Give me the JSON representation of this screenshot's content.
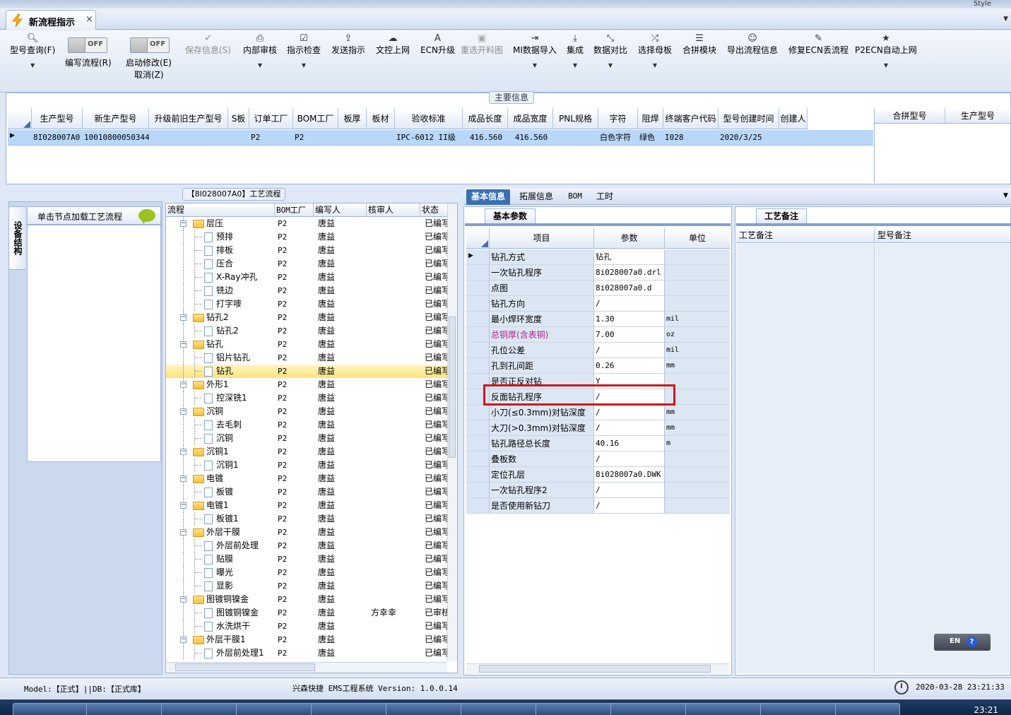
{
  "window": {
    "style_label": "Style",
    "tab_title": "新流程指示",
    "tab_close": "×"
  },
  "toolbar": {
    "items": [
      {
        "label": "型号查询(F)",
        "icon": "search-icon"
      },
      {
        "label": "编写流程(R)",
        "toggle": "OFF"
      },
      {
        "label": "启动修改(E)",
        "label2": "取消(Z)",
        "toggle": "OFF"
      },
      {
        "label": "保存信息(S)",
        "icon": "check-icon",
        "disabled": true
      },
      {
        "label": "内部审核",
        "icon": "printer-icon"
      },
      {
        "label": "指示检查",
        "icon": "checklist-icon"
      },
      {
        "label": "发送指示",
        "icon": "upload-icon"
      },
      {
        "label": "文控上网",
        "icon": "cloud-upload-icon"
      },
      {
        "label": "ECN升级",
        "icon": "ecn-icon"
      },
      {
        "label": "重选开料图",
        "icon": "image-icon",
        "disabled": true
      },
      {
        "label": "MI数据导入",
        "icon": "import-icon"
      },
      {
        "label": "集成",
        "icon": "download-icon"
      },
      {
        "label": "数据对比",
        "icon": "compare-icon"
      },
      {
        "label": "选择母板",
        "icon": "shuffle-icon"
      },
      {
        "label": "合拼模块",
        "icon": "list-icon"
      },
      {
        "label": "导出流程信息",
        "icon": "smile-icon"
      },
      {
        "label": "修复ECN丢流程",
        "icon": "wrench-icon"
      },
      {
        "label": "P2ECN自动上网",
        "icon": "star-icon"
      }
    ]
  },
  "main_info": {
    "title": "主要信息",
    "columns": [
      "生产型号",
      "新生产型号",
      "升级前旧生产型号",
      "S板",
      "订单工厂",
      "BOM工厂",
      "板厚",
      "板材",
      "验收标准",
      "成品长度",
      "成品宽度",
      "PNL规格",
      "字符",
      "阻焊",
      "终端客户代码",
      "型号创建时间",
      "创建人"
    ],
    "row": [
      "8I028007A0",
      "10010800050344",
      "",
      "",
      "P2",
      "P2",
      "",
      "",
      "IPC-6012 II级",
      "416.560",
      "416.560",
      "",
      "白色字符",
      "绿色",
      "I028",
      "2020/3/25",
      ""
    ],
    "side_columns": [
      "合拼型号",
      "生产型号"
    ]
  },
  "left_panel": {
    "vertical_tab": "设备结构",
    "header": "单击节点加载工艺流程"
  },
  "tree": {
    "title": "【8I028007A0】工艺流程",
    "columns": [
      "流程",
      "BOM工厂",
      "编写人",
      "核审人",
      "状态"
    ],
    "rows": [
      {
        "name": "层压",
        "level": 0,
        "bom": "P2",
        "writer": "唐益",
        "reviewer": "",
        "status": "已编写"
      },
      {
        "name": "预排",
        "level": 1,
        "bom": "P2",
        "writer": "唐益",
        "reviewer": "",
        "status": "已编写"
      },
      {
        "name": "排板",
        "level": 1,
        "bom": "P2",
        "writer": "唐益",
        "reviewer": "",
        "status": "已编写"
      },
      {
        "name": "压合",
        "level": 1,
        "bom": "P2",
        "writer": "唐益",
        "reviewer": "",
        "status": "已编写"
      },
      {
        "name": "X-Ray冲孔",
        "level": 1,
        "bom": "P2",
        "writer": "唐益",
        "reviewer": "",
        "status": "已编写"
      },
      {
        "name": "铣边",
        "level": 1,
        "bom": "P2",
        "writer": "唐益",
        "reviewer": "",
        "status": "已编写"
      },
      {
        "name": "打字嘜",
        "level": 1,
        "bom": "P2",
        "writer": "唐益",
        "reviewer": "",
        "status": "已编写"
      },
      {
        "name": "钻孔2",
        "level": 0,
        "bom": "P2",
        "writer": "唐益",
        "reviewer": "",
        "status": "已编写"
      },
      {
        "name": "钻孔2",
        "level": 1,
        "bom": "P2",
        "writer": "唐益",
        "reviewer": "",
        "status": "已编写"
      },
      {
        "name": "钻孔",
        "level": 0,
        "bom": "P2",
        "writer": "唐益",
        "reviewer": "",
        "status": "已编写"
      },
      {
        "name": "铝片钻孔",
        "level": 1,
        "bom": "P2",
        "writer": "唐益",
        "reviewer": "",
        "status": "已编写"
      },
      {
        "name": "钻孔",
        "level": 1,
        "bom": "P2",
        "writer": "唐益",
        "reviewer": "",
        "status": "已编写",
        "selected": true
      },
      {
        "name": "外形1",
        "level": 0,
        "bom": "P2",
        "writer": "唐益",
        "reviewer": "",
        "status": "已编写"
      },
      {
        "name": "控深铣1",
        "level": 1,
        "bom": "P2",
        "writer": "唐益",
        "reviewer": "",
        "status": "已编写"
      },
      {
        "name": "沉铜",
        "level": 0,
        "bom": "P2",
        "writer": "唐益",
        "reviewer": "",
        "status": "已编写"
      },
      {
        "name": "去毛刺",
        "level": 1,
        "bom": "P2",
        "writer": "唐益",
        "reviewer": "",
        "status": "已编写"
      },
      {
        "name": "沉铜",
        "level": 1,
        "bom": "P2",
        "writer": "唐益",
        "reviewer": "",
        "status": "已编写"
      },
      {
        "name": "沉铜1",
        "level": 0,
        "bom": "P2",
        "writer": "唐益",
        "reviewer": "",
        "status": "已编写"
      },
      {
        "name": "沉铜1",
        "level": 1,
        "bom": "P2",
        "writer": "唐益",
        "reviewer": "",
        "status": "已编写"
      },
      {
        "name": "电镀",
        "level": 0,
        "bom": "P2",
        "writer": "唐益",
        "reviewer": "",
        "status": "已编写"
      },
      {
        "name": "板镀",
        "level": 1,
        "bom": "P2",
        "writer": "唐益",
        "reviewer": "",
        "status": "已编写"
      },
      {
        "name": "电镀1",
        "level": 0,
        "bom": "P2",
        "writer": "唐益",
        "reviewer": "",
        "status": "已编写"
      },
      {
        "name": "板镀1",
        "level": 1,
        "bom": "P2",
        "writer": "唐益",
        "reviewer": "",
        "status": "已编写"
      },
      {
        "name": "外层干膜",
        "level": 0,
        "bom": "P2",
        "writer": "唐益",
        "reviewer": "",
        "status": "已编写"
      },
      {
        "name": "外层前处理",
        "level": 1,
        "bom": "P2",
        "writer": "唐益",
        "reviewer": "",
        "status": "已编写"
      },
      {
        "name": "贴膜",
        "level": 1,
        "bom": "P2",
        "writer": "唐益",
        "reviewer": "",
        "status": "已编写"
      },
      {
        "name": "曝光",
        "level": 1,
        "bom": "P2",
        "writer": "唐益",
        "reviewer": "",
        "status": "已编写"
      },
      {
        "name": "显影",
        "level": 1,
        "bom": "P2",
        "writer": "唐益",
        "reviewer": "",
        "status": "已编写"
      },
      {
        "name": "图镀铜镍金",
        "level": 0,
        "bom": "P2",
        "writer": "唐益",
        "reviewer": "",
        "status": "已编写"
      },
      {
        "name": "图镀铜镍金",
        "level": 1,
        "bom": "P2",
        "writer": "唐益",
        "reviewer": "方幸幸",
        "status": "已审核"
      },
      {
        "name": "水洗烘干",
        "level": 1,
        "bom": "P2",
        "writer": "唐益",
        "reviewer": "",
        "status": "已编写"
      },
      {
        "name": "外层干膜1",
        "level": 0,
        "bom": "P2",
        "writer": "唐益",
        "reviewer": "",
        "status": "已编写"
      },
      {
        "name": "外层前处理1",
        "level": 1,
        "bom": "P2",
        "writer": "唐益",
        "reviewer": "",
        "status": "已编写"
      }
    ]
  },
  "right_tabs": [
    "基本信息",
    "拓展信息",
    "BOM",
    "工时"
  ],
  "basic": {
    "subtab": "基本参数",
    "columns": [
      "项目",
      "参数",
      "单位"
    ],
    "rows": [
      {
        "item": "钻孔方式",
        "value": "钻孔",
        "unit": ""
      },
      {
        "item": "一次钻孔程序",
        "value": "8i028007a0.drl",
        "unit": ""
      },
      {
        "item": "点图",
        "value": "8i028007a0.d",
        "unit": ""
      },
      {
        "item": "钻孔方向",
        "value": "/",
        "unit": ""
      },
      {
        "item": "最小焊环宽度",
        "value": "1.30",
        "unit": "mil"
      },
      {
        "item": "总铜厚(含表铜)",
        "value": "7.00",
        "unit": "oz",
        "pink": true
      },
      {
        "item": "孔位公差",
        "value": "/",
        "unit": "mil"
      },
      {
        "item": "孔到孔间距",
        "value": "0.26",
        "unit": "mm"
      },
      {
        "item": "是否正反对钻",
        "value": "Y",
        "unit": ""
      },
      {
        "item": "反面钻孔程序",
        "value": "/",
        "unit": ""
      },
      {
        "item": "小刀(≤0.3mm)对钻深度",
        "value": "/",
        "unit": "mm"
      },
      {
        "item": "大刀(>0.3mm)对钻深度",
        "value": "/",
        "unit": "mm"
      },
      {
        "item": "钻孔路径总长度",
        "value": "40.16",
        "unit": "m"
      },
      {
        "item": "叠板数",
        "value": "/",
        "unit": ""
      },
      {
        "item": "定位孔层",
        "value": "8i028007a0.DWK",
        "unit": ""
      },
      {
        "item": "一次钻孔程序2",
        "value": "/",
        "unit": ""
      },
      {
        "item": "是否使用新钻刀",
        "value": "/",
        "unit": ""
      }
    ]
  },
  "craft": {
    "subtab": "工艺备注",
    "columns": [
      "工艺备注",
      "型号备注"
    ]
  },
  "lang_bar": {
    "lang": "EN",
    "help": "?"
  },
  "status": {
    "model": "Model:【正式】||DB:【正式库】",
    "app": "兴森快捷 EMS工程系统 Version: 1.0.0.14",
    "time": "2020-03-28 23:21:33"
  },
  "taskbar": {
    "time": "23:21"
  }
}
